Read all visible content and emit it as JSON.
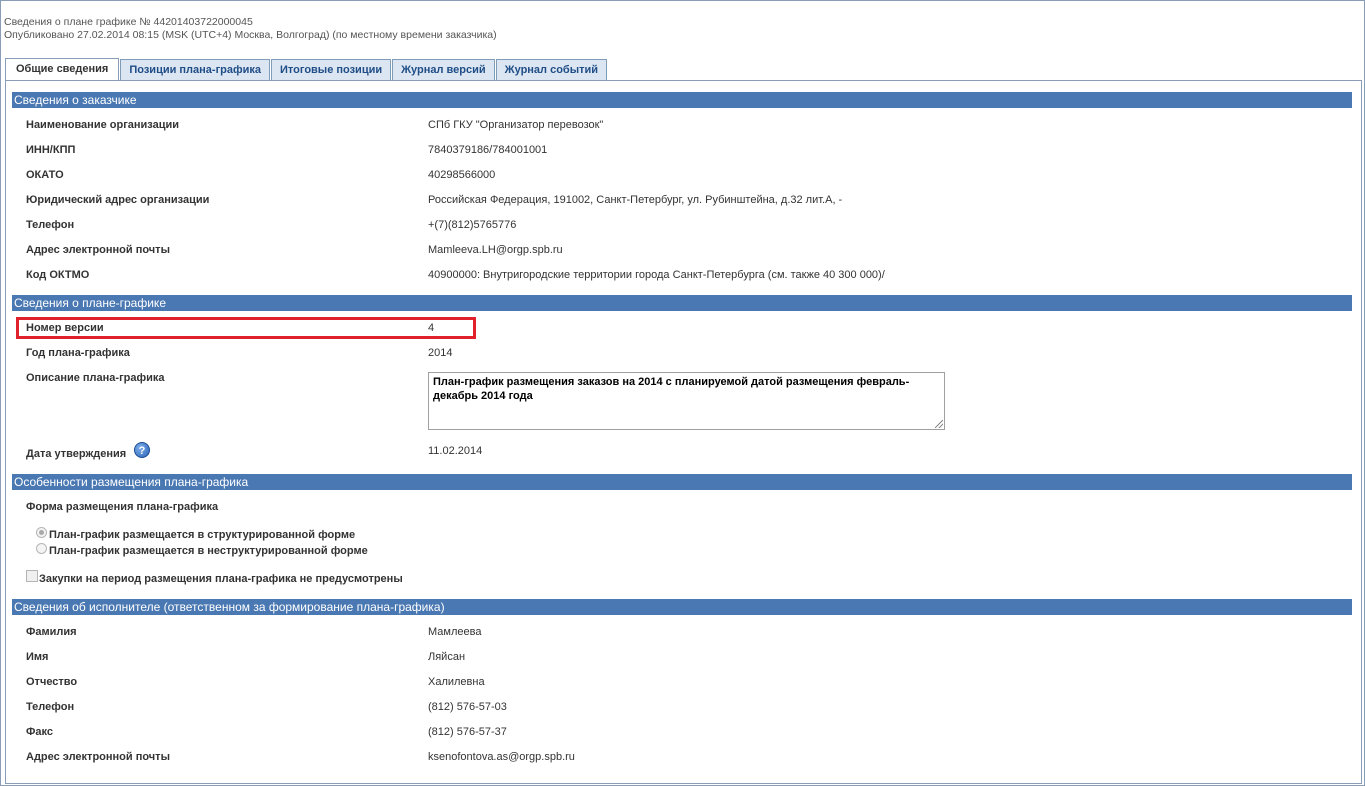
{
  "header": {
    "title": "Сведения о плане графике № 44201403722000045",
    "published": "Опубликовано 27.02.2014 08:15 (MSK (UTC+4) Москва, Волгоград) (по местному времени заказчика)"
  },
  "tabs": [
    "Общие сведения",
    "Позиции плана-графика",
    "Итоговые позиции",
    "Журнал версий",
    "Журнал событий"
  ],
  "customer": {
    "section_title": "Сведения о заказчике",
    "rows": [
      {
        "label": "Наименование организации",
        "value": "СПб ГКУ \"Организатор перевозок\""
      },
      {
        "label": "ИНН/КПП",
        "value": "7840379186/784001001"
      },
      {
        "label": "ОКАТО",
        "value": "40298566000"
      },
      {
        "label": "Юридический адрес организации",
        "value": "Российская Федерация, 191002, Санкт-Петербург, ул. Рубинштейна, д.32 лит.А, -"
      },
      {
        "label": "Телефон",
        "value": "+(7)(812)5765776"
      },
      {
        "label": "Адрес электронной почты",
        "value": "Mamleeva.LH@orgp.spb.ru"
      },
      {
        "label": "Код ОКТМО",
        "value": "40900000: Внутригородские территории города Санкт-Петербурга (см. также 40 300 000)/"
      }
    ]
  },
  "plan": {
    "section_title": "Сведения о плане-графике",
    "version_label": "Номер версии",
    "version_value": "4",
    "year_label": "Год плана-графика",
    "year_value": "2014",
    "description_label": "Описание плана-графика",
    "description_value": "План-график размещения заказов на 2014 с планируемой датой размещения февраль-декабрь 2014 года",
    "approval_label": "Дата утверждения",
    "approval_value": "11.02.2014",
    "help_icon": "?"
  },
  "placement": {
    "section_title": "Особенности размещения плана-графика",
    "form_label": "Форма размещения плана-графика",
    "option_structured": "План-график размещается в структурированной форме",
    "option_unstructured": "План-график размещается в неструктурированной форме",
    "selected": "structured",
    "no_purchases_label": "Закупки на период размещения плана-графика не предусмотрены",
    "no_purchases_checked": false
  },
  "executor": {
    "section_title": "Сведения об исполнителе (ответственном за формирование плана-графика)",
    "rows": [
      {
        "label": "Фамилия",
        "value": "Мамлеева"
      },
      {
        "label": "Имя",
        "value": "Ляйсан"
      },
      {
        "label": "Отчество",
        "value": "Халилевна"
      },
      {
        "label": "Телефон",
        "value": "(812) 576-57-03"
      },
      {
        "label": "Факс",
        "value": "(812) 576-57-37"
      },
      {
        "label": "Адрес электронной почты",
        "value": "ksenofontova.as@orgp.spb.ru"
      }
    ]
  },
  "colors": {
    "section_header": "#4a78b2",
    "highlight": "#e0202a",
    "tab_bg": "#dce6f2"
  }
}
